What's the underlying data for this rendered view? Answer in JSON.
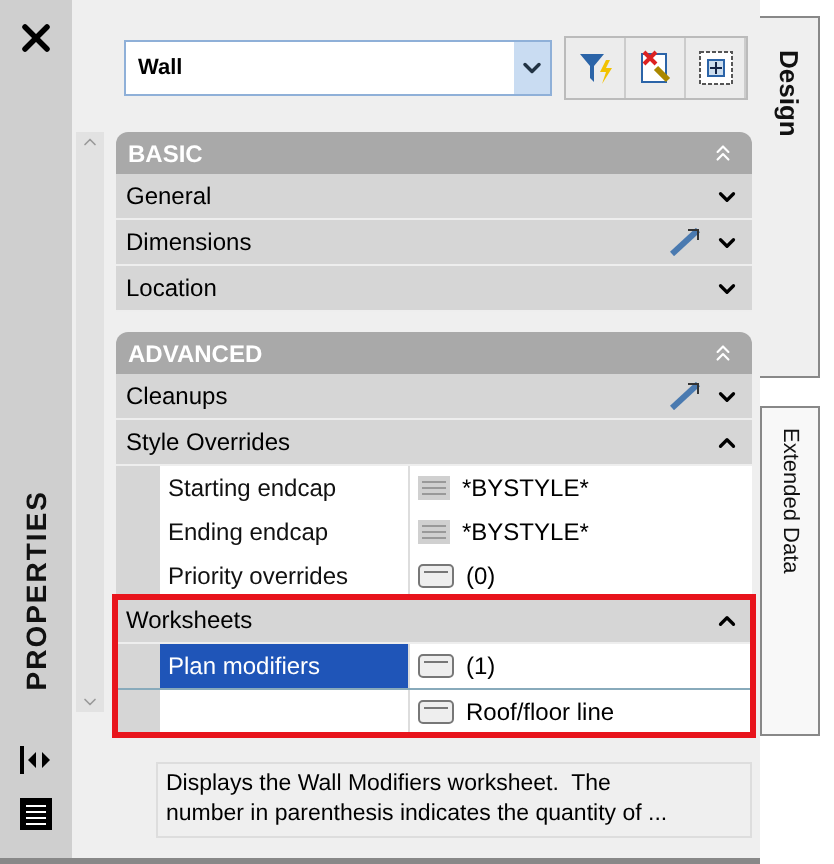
{
  "panel_title": "PROPERTIES",
  "object_select": {
    "value": "Wall"
  },
  "sections": [
    {
      "title": "BASIC",
      "expanded": true,
      "categories": [
        {
          "label": "General",
          "expanded": false,
          "has_tool": false,
          "highlighted": false
        },
        {
          "label": "Dimensions",
          "expanded": false,
          "has_tool": true,
          "highlighted": false
        },
        {
          "label": "Location",
          "expanded": false,
          "has_tool": false,
          "highlighted": false
        }
      ]
    },
    {
      "title": "ADVANCED",
      "expanded": true,
      "categories": [
        {
          "label": "Cleanups",
          "expanded": false,
          "has_tool": true,
          "highlighted": false
        },
        {
          "label": "Style Overrides",
          "expanded": true,
          "has_tool": false,
          "highlighted": false,
          "properties": [
            {
              "name": "Starting endcap",
              "value": "*BYSTYLE*",
              "kind": "style",
              "selected": false
            },
            {
              "name": "Ending endcap",
              "value": "*BYSTYLE*",
              "kind": "style",
              "selected": false
            },
            {
              "name": "Priority overrides",
              "value": "(0)",
              "kind": "sheet",
              "selected": false
            }
          ]
        },
        {
          "label": "Worksheets",
          "expanded": true,
          "has_tool": false,
          "highlighted": true,
          "properties": [
            {
              "name": "Plan modifiers",
              "value": "(1)",
              "kind": "sheet",
              "selected": true
            },
            {
              "value": "Roof/floor line",
              "kind": "sheet",
              "selected": false
            }
          ]
        }
      ]
    }
  ],
  "description": "Displays the Wall Modifiers worksheet.  The number in parenthesis indicates the quantity of ...",
  "side_tabs": [
    {
      "label": "Design",
      "selected": true
    },
    {
      "label": "Extended Data",
      "selected": false
    }
  ]
}
